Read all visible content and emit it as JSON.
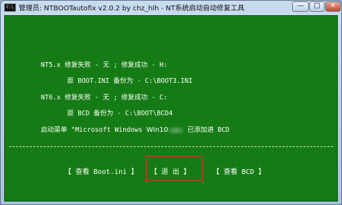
{
  "window": {
    "icon_label": "C:\\",
    "title": "管理员: NTBOOTautofix v2.0.2 by chz_hlh - NT系统启动自动修复工具",
    "controls": {
      "minimize": "—",
      "maximize": "□",
      "close": "✕"
    }
  },
  "report": {
    "nt5_status": "NT5.x 修复失败 - 无 ;    修复成功 - H:",
    "nt5_backup": "原 BOOT.INI 备份为 - C:\\BOOT3.INI",
    "nt6_status": "NT6.x 修复失败 - 无 ;    修复成功 - C:",
    "nt6_backup": "原 BCD 备份为 - C:\\BOOT\\BCD4",
    "menu_prefix": "启动菜单 \"Microsoft Windows ",
    "menu_os": "Win10",
    "menu_suffix": " 已添加进 BCD"
  },
  "actions": {
    "view_boot_ini": "【 查看 Boot.ini 】",
    "exit": "【 退  出 】",
    "view_bcd": "【   查看  BCD   】"
  },
  "colors": {
    "console_bg": "#157c15",
    "text": "#ffffff",
    "focus_border": "#e0302a"
  }
}
